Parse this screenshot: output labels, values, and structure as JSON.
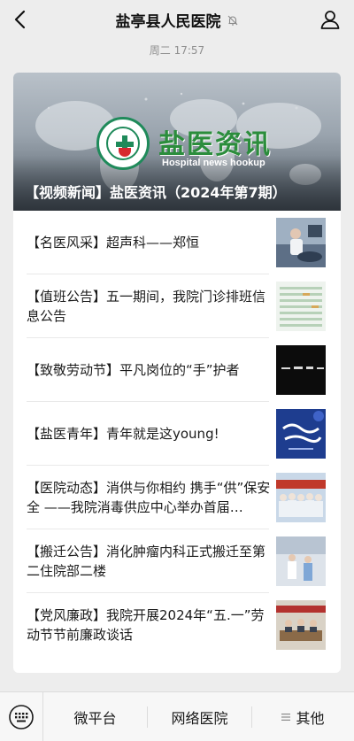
{
  "header": {
    "title": "盐亭县人民医院",
    "back_icon": "chevron-left-icon",
    "mute_icon": "bell-off-icon",
    "profile_icon": "person-icon"
  },
  "timestamp": "周二 17:57",
  "article": {
    "cover": {
      "brand_text": "盐医资讯",
      "brand_subtext": "Hospital news hookup",
      "title": "【视频新闻】盐医资讯（2024年第7期）"
    },
    "items": [
      {
        "title": "【名医风采】超声科——郑恒"
      },
      {
        "title": "【值班公告】五一期间，我院门诊排班信息公告"
      },
      {
        "title": "【致敬劳动节】平凡岗位的“手”护者"
      },
      {
        "title": "【盐医青年】青年就是这young!"
      },
      {
        "title": "【医院动态】消供与你相约  携手“供”保安全 ——我院消毒供应中心举办首届…"
      },
      {
        "title": "【搬迁公告】消化肿瘤内科正式搬迁至第二住院部二楼"
      },
      {
        "title": "【党风廉政】我院开展2024年“五.一”劳动节节前廉政谈话"
      }
    ]
  },
  "footer": {
    "keyboard_icon": "keyboard-icon",
    "menus": [
      {
        "label": "微平台"
      },
      {
        "label": "网络医院"
      },
      {
        "label": "其他",
        "icon": "menu-lines-icon"
      }
    ]
  },
  "colors": {
    "background": "#ededed",
    "brand_green": "#2b8d3c",
    "card": "#ffffff"
  }
}
